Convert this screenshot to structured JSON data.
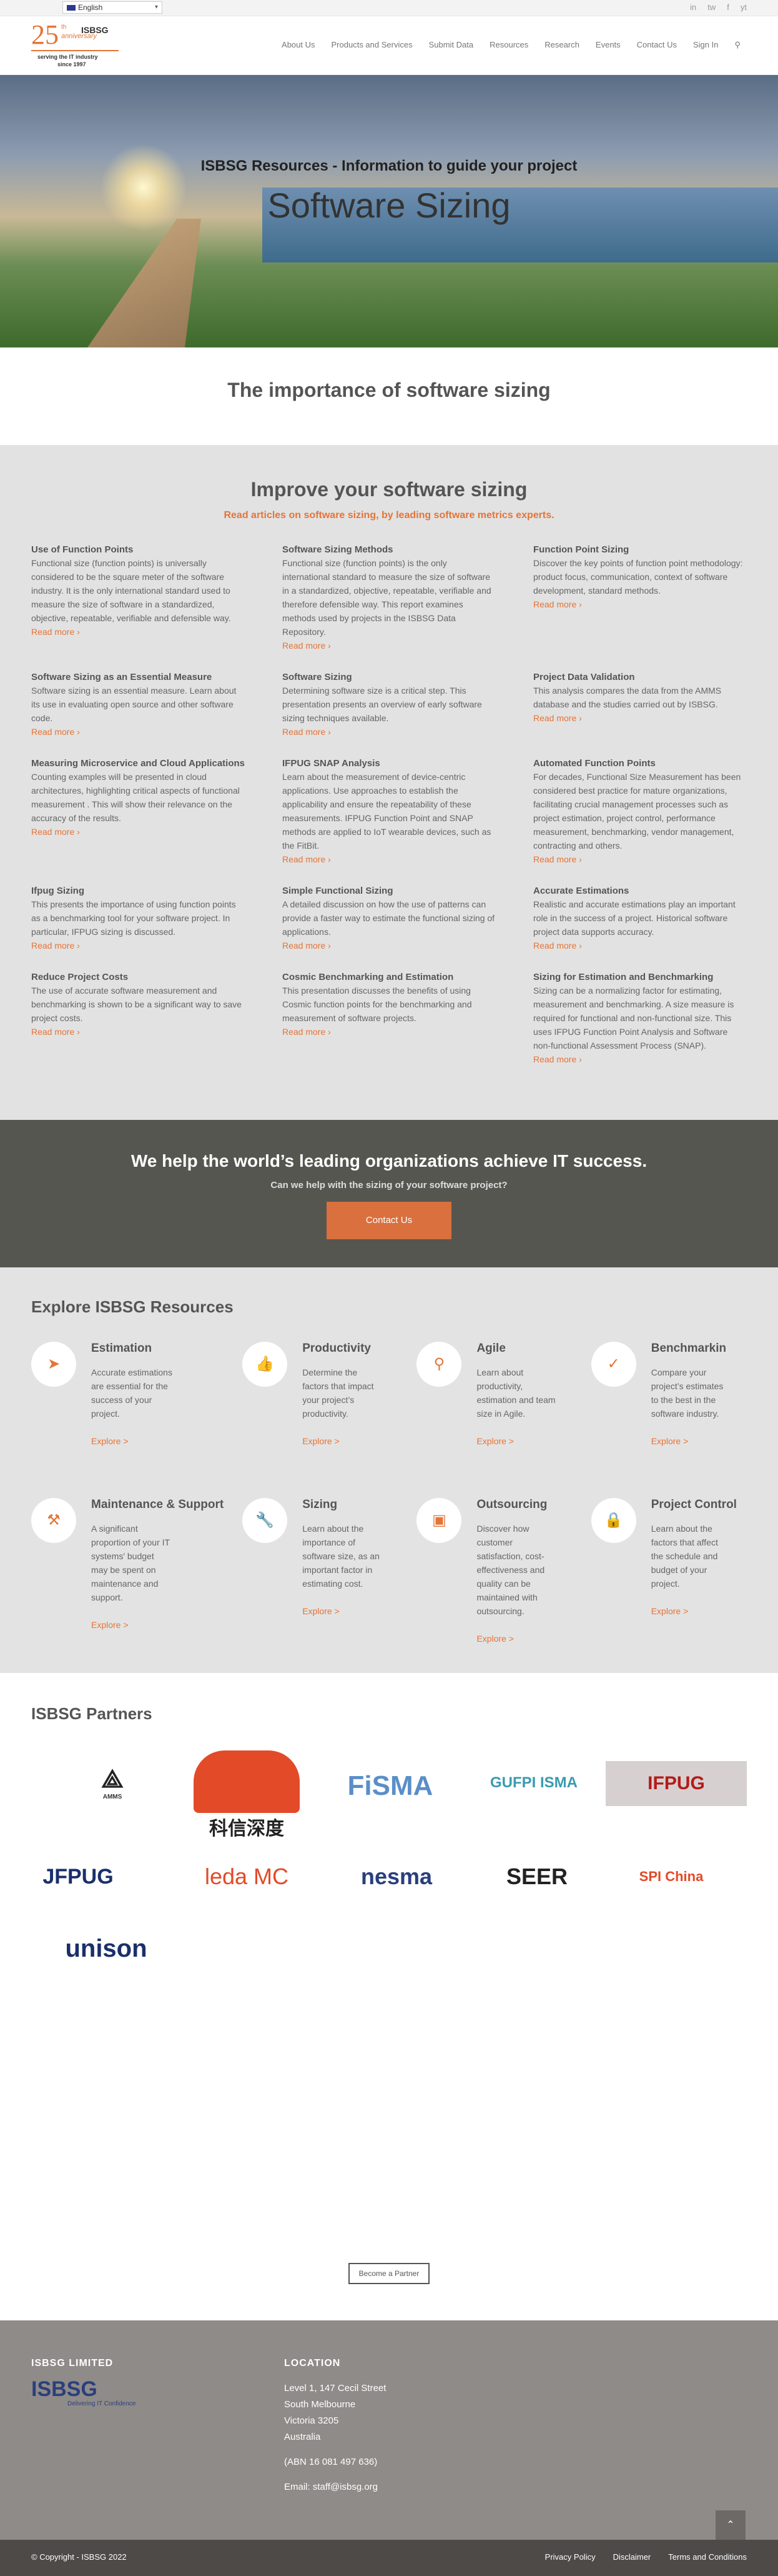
{
  "topbar": {
    "language": "English",
    "social": [
      "in",
      "tw",
      "f",
      "yt"
    ]
  },
  "logo": {
    "number": "25",
    "sup": "th",
    "anniversary": "anniversary",
    "brand": "ISBSG",
    "tag1": "serving the IT industry",
    "tag2": "since 1997"
  },
  "nav": [
    "About Us",
    "Products and Services",
    "Submit Data",
    "Resources",
    "Research",
    "Events",
    "Contact Us",
    "Sign In"
  ],
  "hero": {
    "subtitle": "ISBSG Resources - Information to guide your project",
    "title": "Software Sizing"
  },
  "importance": {
    "heading": "The importance of software sizing"
  },
  "articles": {
    "heading": "Improve your software sizing",
    "subheading": "Read articles on software sizing, by leading software metrics experts.",
    "read_more": "Read more",
    "items": [
      {
        "title": "Use of Function Points",
        "text": "Functional size (function points) is universally considered to be the square meter of the software industry. It is the only international standard used to measure the size of software in a standardized, objective, repeatable, verifiable and defensible way."
      },
      {
        "title": "Software Sizing Methods",
        "text": "Functional size (function points) is the only international standard to measure the size of software in a standardized, objective, repeatable, verifiable and therefore defensible way. This report examines methods used by projects in the ISBSG Data Repository."
      },
      {
        "title": "Function Point Sizing",
        "text": "Discover the key points of function point methodology: product focus, communication, context of software development, standard methods."
      },
      {
        "title": "Software Sizing as an Essential Measure",
        "text": "Software sizing is an essential measure. Learn about its use in evaluating open source and other software code."
      },
      {
        "title": "Software Sizing",
        "text": "Determining software size is a critical step. This presentation presents an overview of early software sizing techniques available."
      },
      {
        "title": "Project Data Validation",
        "text": "This analysis compares the data from the AMMS database and the studies carried out by ISBSG."
      },
      {
        "title": "Measuring Microservice and Cloud Applications",
        "text": "Counting examples will be presented in cloud architectures, highlighting critical aspects of functional measurement . This will show their relevance on the accuracy of the results."
      },
      {
        "title": "IFPUG SNAP Analysis",
        "text": "Learn about the measurement of device-centric applications. Use approaches to establish the applicability and ensure the repeatability of these measurements. IFPUG Function Point and SNAP methods are applied to IoT wearable devices, such as the FitBit."
      },
      {
        "title": "Automated Function Points",
        "text": "For decades, Functional Size Measurement has been considered best practice for mature organizations, facilitating crucial management processes such as project estimation, project control, performance measurement, benchmarking, vendor management, contracting and others."
      },
      {
        "title": "Ifpug Sizing",
        "text": "This presents the importance of using function points as a benchmarking tool for your software project. In particular, IFPUG sizing is discussed."
      },
      {
        "title": "Simple Functional Sizing",
        "text": "A detailed discussion on how the use of patterns can provide a faster way to estimate the functional sizing of applications."
      },
      {
        "title": "Accurate Estimations",
        "text": "Realistic and accurate estimations play an important role in the success of a project. Historical software project data supports accuracy."
      },
      {
        "title": "Reduce Project Costs",
        "text": "The use of accurate software measurement and benchmarking is shown to be a significant way to save project costs."
      },
      {
        "title": "Cosmic Benchmarking and Estimation",
        "text": "This presentation discusses the benefits of using Cosmic function points for the benchmarking and measurement of software projects."
      },
      {
        "title": "Sizing for Estimation and Benchmarking",
        "text": "Sizing can be a normalizing factor for estimating, measurement and benchmarking. A size measure is required for functional and non-functional size. This uses IFPUG Function Point Analysis and Software non-functional Assessment Process (SNAP)."
      }
    ]
  },
  "cta": {
    "heading": "We help the world’s leading organizations achieve IT success.",
    "sub": "Can we help with the sizing of your software project?",
    "button": "Contact Us"
  },
  "explore": {
    "heading": "Explore ISBSG Resources",
    "items": [
      {
        "title": "Estimation",
        "text": "Accurate estimations are essential for the success of your project.",
        "link": "Explore >",
        "icon": "navigation-arrow-icon"
      },
      {
        "title": "Productivity",
        "text": "Determine the factors that impact your project’s productivity.",
        "link": "Explore >",
        "icon": "thumbs-up-icon"
      },
      {
        "title": "Agile",
        "text": "Learn about productivity, estimation and team size in Agile.",
        "link": "Explore >",
        "icon": "search-icon"
      },
      {
        "title": "Benchmarkin",
        "text": "Compare your project’s estimates to the best in the software industry.",
        "link": "Explore >",
        "icon": "checkmark-icon"
      },
      {
        "title": "Maintenance & Support",
        "text": "A significant proportion of your IT systems' budget may be spent on maintenance and support.",
        "link": "Explore >",
        "icon": "tools-icon"
      },
      {
        "title": "Sizing",
        "text": "Learn about the importance of software size, as an important factor in estimating cost.",
        "link": "Explore >",
        "icon": "wrench-icon"
      },
      {
        "title": "Outsourcing",
        "text": "Discover how customer satisfaction, cost-effectiveness and quality can be maintained with outsourcing.",
        "link": "Explore >",
        "icon": "briefcase-icon"
      },
      {
        "title": "Project Control",
        "text": "Learn about the factors that affect the schedule and budget of your project.",
        "link": "Explore >",
        "icon": "lock-icon"
      }
    ]
  },
  "partners": {
    "heading": "ISBSG Partners",
    "logos": [
      "AMMS",
      "科信深度",
      "FiSMA",
      "GUFPI ISMA",
      "IFPUG",
      "JFPUG",
      "leda MC",
      "nesma",
      "SEER",
      "SPI China",
      "unison"
    ],
    "button": "Become a Partner"
  },
  "footer": {
    "col1_heading": "ISBSG LIMITED",
    "col1_logo": "ISBSG",
    "col1_tag": "Delivering IT Confidence",
    "col2_heading": "LOCATION",
    "address": [
      "Level 1, 147 Cecil Street",
      "South Melbourne",
      "Victoria 3205",
      "Australia"
    ],
    "abn": "(ABN 16 081 497 636)",
    "email": "Email: staff@isbsg.org"
  },
  "copyright": {
    "text": "© Copyright - ISBSG 2022",
    "links": [
      "Privacy Policy",
      "Disclaimer",
      "Terms and Conditions"
    ]
  },
  "colors": {
    "accent": "#e57437",
    "cta_bg": "#565651",
    "footer_bg": "#8f8b88"
  }
}
